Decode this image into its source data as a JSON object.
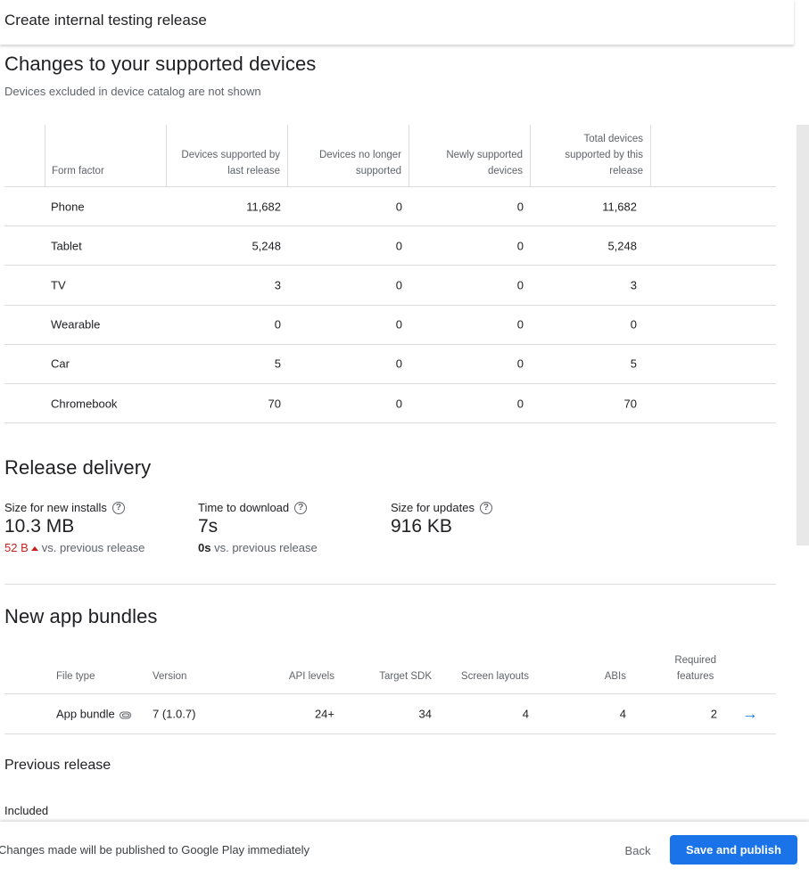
{
  "header": {
    "title": "Create internal testing release"
  },
  "devices": {
    "heading": "Changes to your supported devices",
    "subtitle": "Devices excluded in device catalog are not shown",
    "columns": [
      "Form factor",
      "Devices supported by\nlast release",
      "Devices no longer\nsupported",
      "Newly supported\ndevices",
      "Total devices\nsupported by this\nrelease"
    ],
    "rows": [
      {
        "form": "Phone",
        "last": "11,682",
        "removed": "0",
        "added": "0",
        "total": "11,682"
      },
      {
        "form": "Tablet",
        "last": "5,248",
        "removed": "0",
        "added": "0",
        "total": "5,248"
      },
      {
        "form": "TV",
        "last": "3",
        "removed": "0",
        "added": "0",
        "total": "3"
      },
      {
        "form": "Wearable",
        "last": "0",
        "removed": "0",
        "added": "0",
        "total": "0"
      },
      {
        "form": "Car",
        "last": "5",
        "removed": "0",
        "added": "0",
        "total": "5"
      },
      {
        "form": "Chromebook",
        "last": "70",
        "removed": "0",
        "added": "0",
        "total": "70"
      }
    ]
  },
  "delivery": {
    "heading": "Release delivery",
    "new_installs": {
      "label": "Size for new installs",
      "value": "10.3 MB",
      "delta": "52 B",
      "delta_suffix": "vs. previous release"
    },
    "download_time": {
      "label": "Time to download",
      "value": "7s",
      "delta": "0s",
      "delta_suffix": "vs. previous release"
    },
    "updates": {
      "label": "Size for updates",
      "value": "916 KB"
    }
  },
  "bundles": {
    "heading": "New app bundles",
    "columns": {
      "file_type": "File type",
      "version": "Version",
      "api_levels": "API levels",
      "target_sdk": "Target SDK",
      "screen_layouts": "Screen layouts",
      "abis": "ABIs",
      "required_features": "Required\nfeatures"
    },
    "row": {
      "file_type": "App bundle",
      "version": "7 (1.0.7)",
      "api_levels": "24+",
      "target_sdk": "34",
      "screen_layouts": "4",
      "abis": "4",
      "required_features": "2"
    }
  },
  "previous": {
    "heading": "Previous release",
    "included": "Included"
  },
  "footer": {
    "message": "Changes made will be published to Google Play immediately",
    "back": "Back",
    "save": "Save and publish"
  },
  "colors": {
    "primary": "#1a73e8",
    "negative": "#c5221f"
  },
  "icons": {
    "help": "help-circle-icon",
    "attachment": "paperclip-icon",
    "details": "arrow-right-icon"
  }
}
